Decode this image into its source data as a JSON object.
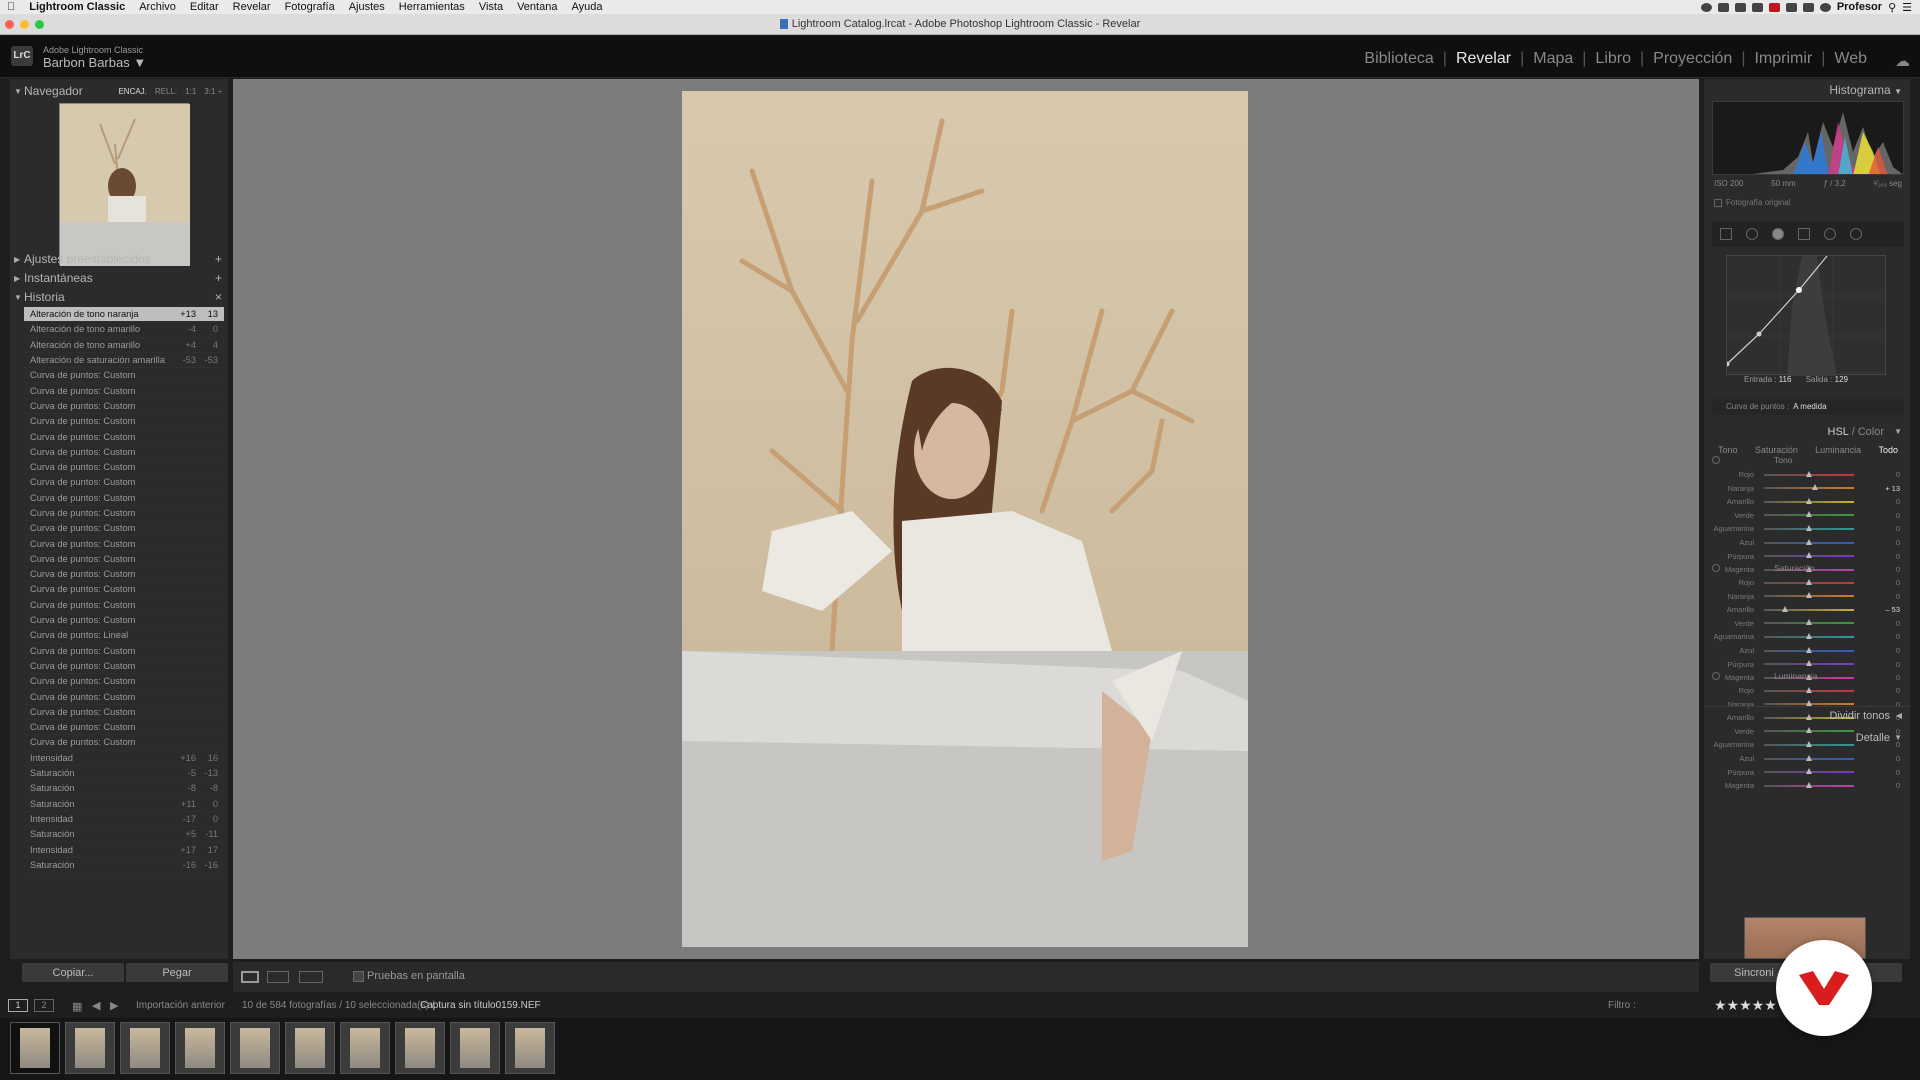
{
  "menubar": {
    "apple": "",
    "app": "Lightroom Classic",
    "items": [
      "Archivo",
      "Editar",
      "Revelar",
      "Fotografía",
      "Ajustes",
      "Herramientas",
      "Vista",
      "Ventana",
      "Ayuda"
    ],
    "user": "Profesor"
  },
  "titlebar": {
    "title": "Lightroom Catalog.lrcat - Adobe Photoshop Lightroom Classic - Revelar"
  },
  "identity": {
    "logo": "LrC",
    "product": "Adobe Lightroom Classic",
    "name": "Barbon Barbas ▼"
  },
  "modules": {
    "items": [
      "Biblioteca",
      "Revelar",
      "Mapa",
      "Libro",
      "Proyección",
      "Imprimir",
      "Web"
    ],
    "active": "Revelar"
  },
  "left_panel": {
    "navigator": {
      "title": "Navegador",
      "options": [
        "ENCAJ.",
        "RELL.",
        "1:1",
        "3:1 ÷"
      ]
    },
    "presets": {
      "title": "Ajustes preestablecidos",
      "action": "+"
    },
    "snapshots": {
      "title": "Instantáneas",
      "action": "+"
    },
    "history": {
      "title": "Historia",
      "action": "×",
      "rows": [
        {
          "label": "Alteración de tono naranja",
          "v1": "+13",
          "v2": "13"
        },
        {
          "label": "Alteración de tono amarillo",
          "v1": "-4",
          "v2": "0"
        },
        {
          "label": "Alteración de tono amarillo",
          "v1": "+4",
          "v2": "4"
        },
        {
          "label": "Alteración de saturación amarilla",
          "v1": "-53",
          "v2": "-53"
        },
        {
          "label": "Curva de puntos: Custom",
          "v1": "",
          "v2": ""
        },
        {
          "label": "Curva de puntos: Custom",
          "v1": "",
          "v2": ""
        },
        {
          "label": "Curva de puntos: Custom",
          "v1": "",
          "v2": ""
        },
        {
          "label": "Curva de puntos: Custom",
          "v1": "",
          "v2": ""
        },
        {
          "label": "Curva de puntos: Custom",
          "v1": "",
          "v2": ""
        },
        {
          "label": "Curva de puntos: Custom",
          "v1": "",
          "v2": ""
        },
        {
          "label": "Curva de puntos: Custom",
          "v1": "",
          "v2": ""
        },
        {
          "label": "Curva de puntos: Custom",
          "v1": "",
          "v2": ""
        },
        {
          "label": "Curva de puntos: Custom",
          "v1": "",
          "v2": ""
        },
        {
          "label": "Curva de puntos: Custom",
          "v1": "",
          "v2": ""
        },
        {
          "label": "Curva de puntos: Custom",
          "v1": "",
          "v2": ""
        },
        {
          "label": "Curva de puntos: Custom",
          "v1": "",
          "v2": ""
        },
        {
          "label": "Curva de puntos: Custom",
          "v1": "",
          "v2": ""
        },
        {
          "label": "Curva de puntos: Custom",
          "v1": "",
          "v2": ""
        },
        {
          "label": "Curva de puntos: Custom",
          "v1": "",
          "v2": ""
        },
        {
          "label": "Curva de puntos: Custom",
          "v1": "",
          "v2": ""
        },
        {
          "label": "Curva de puntos: Custom",
          "v1": "",
          "v2": ""
        },
        {
          "label": "Curva de puntos: Lineal",
          "v1": "",
          "v2": ""
        },
        {
          "label": "Curva de puntos: Custom",
          "v1": "",
          "v2": ""
        },
        {
          "label": "Curva de puntos: Custom",
          "v1": "",
          "v2": ""
        },
        {
          "label": "Curva de puntos: Custom",
          "v1": "",
          "v2": ""
        },
        {
          "label": "Curva de puntos: Custom",
          "v1": "",
          "v2": ""
        },
        {
          "label": "Curva de puntos: Custom",
          "v1": "",
          "v2": ""
        },
        {
          "label": "Curva de puntos: Custom",
          "v1": "",
          "v2": ""
        },
        {
          "label": "Curva de puntos: Custom",
          "v1": "",
          "v2": ""
        },
        {
          "label": "Intensidad",
          "v1": "+16",
          "v2": "16"
        },
        {
          "label": "Saturación",
          "v1": "-5",
          "v2": "-13"
        },
        {
          "label": "Saturación",
          "v1": "-8",
          "v2": "-8"
        },
        {
          "label": "Saturación",
          "v1": "+11",
          "v2": "0"
        },
        {
          "label": "Intensidad",
          "v1": "-17",
          "v2": "0"
        },
        {
          "label": "Saturación",
          "v1": "+5",
          "v2": "-11"
        },
        {
          "label": "Intensidad",
          "v1": "+17",
          "v2": "17"
        },
        {
          "label": "Saturación",
          "v1": "-16",
          "v2": "-16"
        }
      ]
    },
    "buttons": {
      "copy": "Copiar...",
      "paste": "Pegar"
    }
  },
  "right_panel": {
    "histogram": {
      "title": "Histograma",
      "iso": "ISO 200",
      "focal": "50 mm",
      "aperture": "ƒ / 3,2",
      "shutter": "¹⁄₁₆₀ seg",
      "original": "Fotografía original"
    },
    "curve": {
      "entrada_label": "Entrada :",
      "entrada": "116",
      "salida_label": "Salida :",
      "salida": "129",
      "points_label": "Curva de puntos :",
      "points_value": "A medida"
    },
    "hsl": {
      "title_hsl": "HSL",
      "title_sep": " / ",
      "title_color": "Color",
      "tabs": [
        "Tono",
        "Saturación",
        "Luminancia",
        "Todo"
      ],
      "active_tab": "Todo",
      "tono": {
        "title": "Tono",
        "rows": [
          {
            "label": "Rojo",
            "value": "0",
            "pos": 0
          },
          {
            "label": "Naranja",
            "value": "+ 13",
            "pos": 0.13
          },
          {
            "label": "Amarillo",
            "value": "0",
            "pos": 0
          },
          {
            "label": "Verde",
            "value": "0",
            "pos": 0
          },
          {
            "label": "Aguamarina",
            "value": "0",
            "pos": 0
          },
          {
            "label": "Azul",
            "value": "0",
            "pos": 0
          },
          {
            "label": "Púrpura",
            "value": "0",
            "pos": 0
          },
          {
            "label": "Magenta",
            "value": "0",
            "pos": 0
          }
        ]
      },
      "saturacion": {
        "title": "Saturación",
        "rows": [
          {
            "label": "Rojo",
            "value": "0",
            "pos": 0
          },
          {
            "label": "Naranja",
            "value": "0",
            "pos": 0
          },
          {
            "label": "Amarillo",
            "value": "– 53",
            "pos": -0.53
          },
          {
            "label": "Verde",
            "value": "0",
            "pos": 0
          },
          {
            "label": "Aguamarina",
            "value": "0",
            "pos": 0
          },
          {
            "label": "Azul",
            "value": "0",
            "pos": 0
          },
          {
            "label": "Púrpura",
            "value": "0",
            "pos": 0
          },
          {
            "label": "Magenta",
            "value": "0",
            "pos": 0
          }
        ]
      },
      "luminancia": {
        "title": "Luminancia",
        "rows": [
          {
            "label": "Rojo",
            "value": "0",
            "pos": 0
          },
          {
            "label": "Naranja",
            "value": "0",
            "pos": 0
          },
          {
            "label": "Amarillo",
            "value": "0",
            "pos": 0
          },
          {
            "label": "Verde",
            "value": "0",
            "pos": 0
          },
          {
            "label": "Aguamarina",
            "value": "0",
            "pos": 0
          },
          {
            "label": "Azul",
            "value": "0",
            "pos": 0
          },
          {
            "label": "Púrpura",
            "value": "0",
            "pos": 0
          },
          {
            "label": "Magenta",
            "value": "0",
            "pos": 0
          }
        ]
      }
    },
    "split_toning": {
      "title": "Dividir tonos"
    },
    "detail": {
      "title": "Detalle"
    },
    "buttons": {
      "sync": "Sincroni",
      "reset": "r"
    }
  },
  "toolbar": {
    "proof_label": "Pruebas en pantalla"
  },
  "filmstrip_bar": {
    "view1": "1",
    "view2": "2",
    "import": "Importación anterior",
    "count": "10 de 584 fotografías / 10 seleccionada(s) /",
    "filename": "Captura sin título0159.NEF",
    "filter_label": "Filtro :",
    "stars": "★★★★★"
  },
  "filmstrip": {
    "thumb_count": 10
  },
  "colors": {
    "accent": "#e8e8e8",
    "badge_red": "#d91c1c",
    "selected_row": "#bdbdbd"
  }
}
